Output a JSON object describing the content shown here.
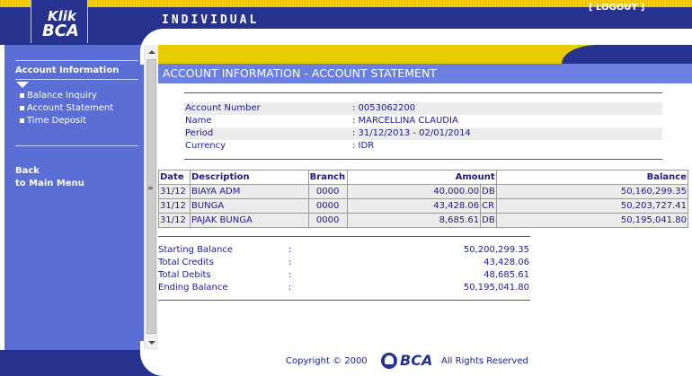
{
  "header": {
    "logo_top": "Klik",
    "logo_bottom": "BCA",
    "title": "INDIVIDUAL",
    "logout": "[ LOGOUT ]"
  },
  "sidebar": {
    "heading": "Account Information",
    "items": [
      {
        "label": "Balance Inquiry"
      },
      {
        "label": "Account Statement"
      },
      {
        "label": "Time Deposit"
      }
    ],
    "back_line1": "Back",
    "back_line2": "to Main Menu"
  },
  "page": {
    "title": "ACCOUNT INFORMATION - ACCOUNT STATEMENT"
  },
  "account": [
    {
      "label": "Account Number",
      "value": ": 0053062200"
    },
    {
      "label": "Name",
      "value": ": MARCELLINA CLAUDIA"
    },
    {
      "label": "Period",
      "value": ": 31/12/2013 - 02/01/2014"
    },
    {
      "label": "Currency",
      "value": ": IDR"
    }
  ],
  "transactions": {
    "headers": {
      "date": "Date",
      "description": "Description",
      "branch": "Branch",
      "amount": "Amount",
      "balance": "Balance"
    },
    "rows": [
      {
        "date": "31/12",
        "description": "BIAYA ADM",
        "branch": "0000",
        "amount": "40,000.00",
        "type": "DB",
        "balance": "50,160,299.35"
      },
      {
        "date": "31/12",
        "description": "BUNGA",
        "branch": "0000",
        "amount": "43,428.06",
        "type": "CR",
        "balance": "50,203,727.41"
      },
      {
        "date": "31/12",
        "description": "PAJAK BUNGA",
        "branch": "0000",
        "amount": "8,685.61",
        "type": "DB",
        "balance": "50,195,041.80"
      }
    ]
  },
  "summary": [
    {
      "label": "Starting Balance",
      "colon": ":",
      "value": "50,200,299.35"
    },
    {
      "label": "Total Credits",
      "colon": ":",
      "value": "43,428.06"
    },
    {
      "label": "Total Debits",
      "colon": ":",
      "value": "48,685.61"
    },
    {
      "label": "Ending Balance",
      "colon": ":",
      "value": "50,195,041.80"
    }
  ],
  "footer": {
    "copyright": "Copyright © 2000",
    "logo_text": "BCA",
    "rights": "All Rights Reserved"
  }
}
